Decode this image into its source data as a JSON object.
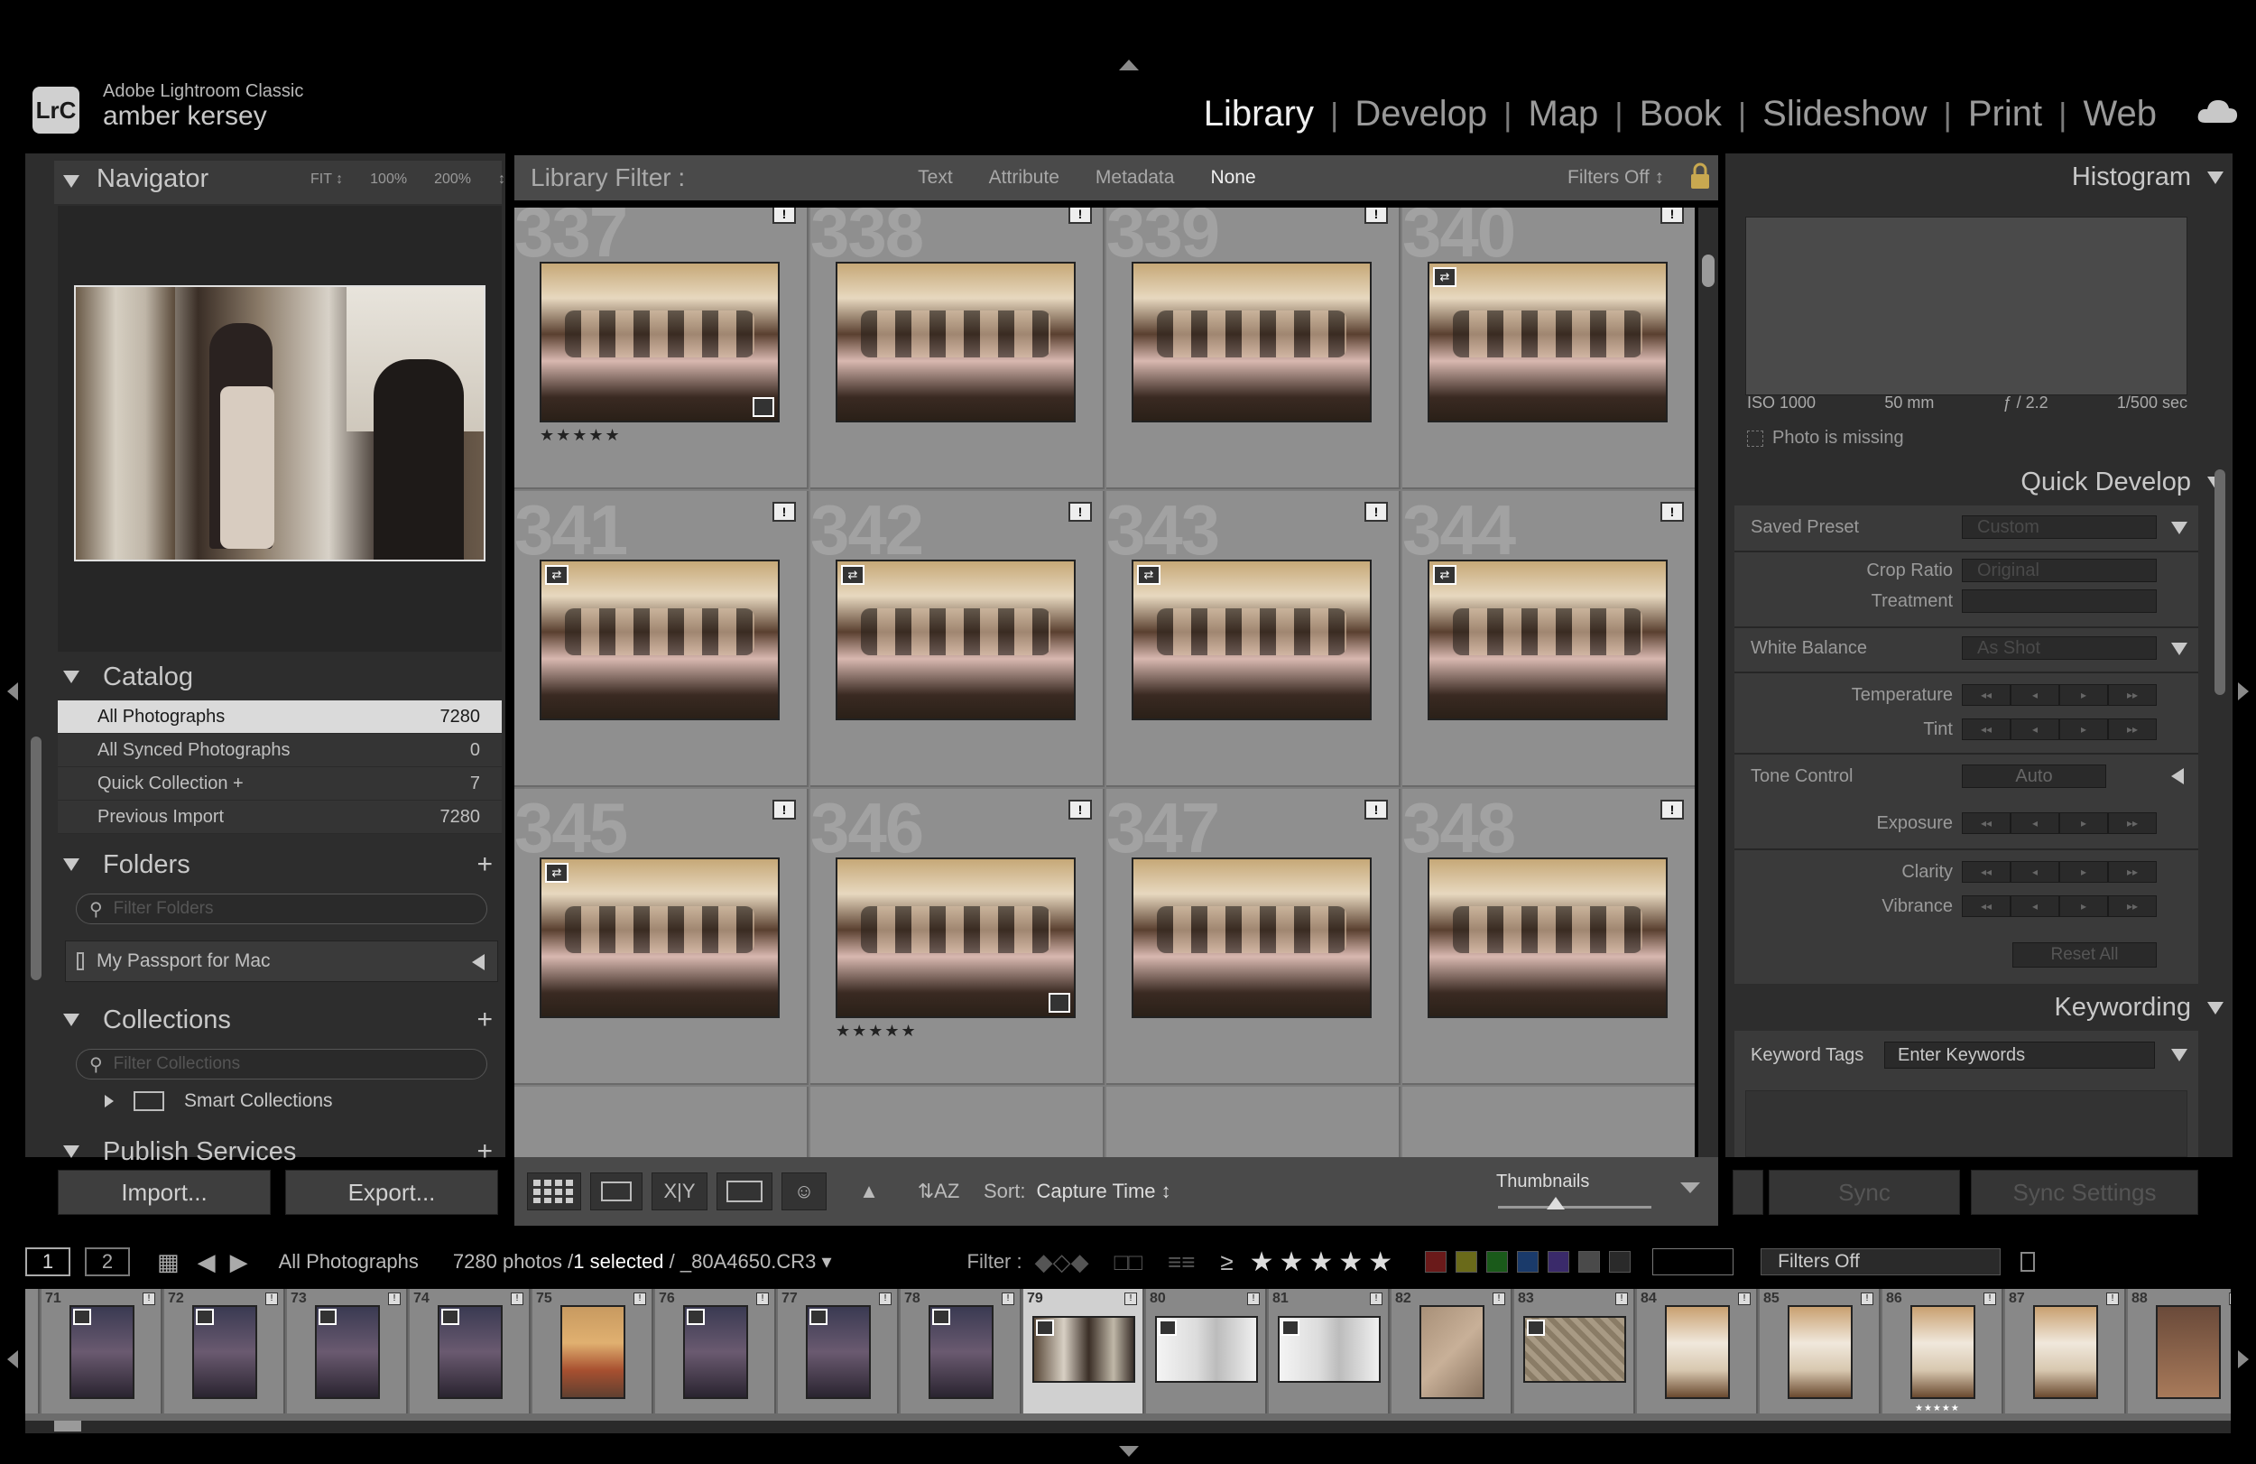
{
  "app": {
    "logo": "LrC",
    "name": "Adobe Lightroom Classic",
    "user": "amber kersey"
  },
  "modules": [
    {
      "label": "Library",
      "active": true
    },
    {
      "label": "Develop"
    },
    {
      "label": "Map"
    },
    {
      "label": "Book"
    },
    {
      "label": "Slideshow"
    },
    {
      "label": "Print"
    },
    {
      "label": "Web"
    }
  ],
  "navigator": {
    "title": "Navigator",
    "zoom": [
      "FIT ↕",
      "100%",
      "200%",
      "↕"
    ]
  },
  "catalog": {
    "title": "Catalog",
    "items": [
      {
        "label": "All Photographs",
        "count": "7280",
        "selected": true
      },
      {
        "label": "All Synced Photographs",
        "count": "0"
      },
      {
        "label": "Quick Collection +",
        "count": "7"
      },
      {
        "label": "Previous Import",
        "count": "7280"
      }
    ]
  },
  "folders": {
    "title": "Folders",
    "filter_placeholder": "Filter Folders",
    "device": "My Passport for Mac"
  },
  "collections": {
    "title": "Collections",
    "filter_placeholder": "Filter Collections",
    "smart": "Smart Collections"
  },
  "publish": {
    "title": "Publish Services"
  },
  "buttons": {
    "import": "Import...",
    "export": "Export..."
  },
  "library_filter": {
    "title": "Library Filter :",
    "tabs": [
      "Text",
      "Attribute",
      "Metadata",
      "None"
    ],
    "active_tab": "None",
    "filters": "Filters Off ↕"
  },
  "grid": {
    "cells": [
      {
        "num": "337",
        "badge": "!",
        "sync": false,
        "edited": true,
        "stars": "★★★★★"
      },
      {
        "num": "338",
        "badge": "!",
        "sync": false,
        "edited": false,
        "stars": ""
      },
      {
        "num": "339",
        "badge": "!",
        "sync": false,
        "edited": false,
        "stars": ""
      },
      {
        "num": "340",
        "badge": "!",
        "sync": true,
        "edited": false,
        "stars": ""
      },
      {
        "num": "341",
        "badge": "!",
        "sync": true,
        "edited": false,
        "stars": ""
      },
      {
        "num": "342",
        "badge": "!",
        "sync": true,
        "edited": false,
        "stars": ""
      },
      {
        "num": "343",
        "badge": "!",
        "sync": true,
        "edited": false,
        "stars": ""
      },
      {
        "num": "344",
        "badge": "!",
        "sync": true,
        "edited": false,
        "stars": ""
      },
      {
        "num": "345",
        "badge": "!",
        "sync": true,
        "edited": false,
        "stars": ""
      },
      {
        "num": "346",
        "badge": "!",
        "sync": false,
        "edited": true,
        "stars": "★★★★★"
      },
      {
        "num": "347",
        "badge": "!",
        "sync": false,
        "edited": false,
        "stars": ""
      },
      {
        "num": "348",
        "badge": "!",
        "sync": false,
        "edited": false,
        "stars": ""
      }
    ]
  },
  "toolbar": {
    "sort_label": "Sort:",
    "sort_value": "Capture Time ↕",
    "thumbnails_label": "Thumbnails"
  },
  "histogram": {
    "title": "Histogram",
    "iso": "ISO 1000",
    "focal": "50 mm",
    "aperture": "ƒ / 2.2",
    "shutter": "1/500 sec",
    "missing": "Photo is missing"
  },
  "quick_develop": {
    "title": "Quick Develop",
    "saved_preset_label": "Saved Preset",
    "saved_preset_value": "Custom",
    "crop_ratio_label": "Crop Ratio",
    "crop_ratio_value": "Original",
    "treatment_label": "Treatment",
    "white_balance_label": "White Balance",
    "white_balance_value": "As Shot",
    "temperature_label": "Temperature",
    "tint_label": "Tint",
    "tone_control_label": "Tone Control",
    "auto_label": "Auto",
    "exposure_label": "Exposure",
    "clarity_label": "Clarity",
    "vibrance_label": "Vibrance",
    "reset_all": "Reset All",
    "steps": [
      "◂◂",
      "◂",
      "▸",
      "▸▸"
    ]
  },
  "keywording": {
    "title": "Keywording",
    "tags_label": "Keyword Tags",
    "tags_value": "Enter Keywords"
  },
  "sync": {
    "sync": "Sync",
    "sync_settings": "Sync Settings"
  },
  "filmstrip_header": {
    "monitor1": "1",
    "monitor2": "2",
    "source": "All Photographs",
    "count": "7280 photos /",
    "selected": "1 selected",
    "filename": "/ _80A4650.CR3 ▾",
    "filter_label": "Filter :",
    "rating_op": "≥",
    "stars": "★★★★★",
    "filters_off": "Filters Off",
    "swatches": [
      "#6a1a1a",
      "#6a6a1a",
      "#1a5a1a",
      "#1a3a6a",
      "#3a2a6a",
      "#4a4a4a",
      "#2a2a2a"
    ]
  },
  "filmstrip": [
    {
      "num": "",
      "kind": "partial"
    },
    {
      "num": "71",
      "kind": "portrait"
    },
    {
      "num": "72",
      "kind": "portrait"
    },
    {
      "num": "73",
      "kind": "portrait"
    },
    {
      "num": "74",
      "kind": "portrait"
    },
    {
      "num": "75",
      "kind": "portrait-warm"
    },
    {
      "num": "76",
      "kind": "portrait"
    },
    {
      "num": "77",
      "kind": "portrait"
    },
    {
      "num": "78",
      "kind": "portrait"
    },
    {
      "num": "79",
      "kind": "landscape",
      "selected": true
    },
    {
      "num": "80",
      "kind": "landscape-bright"
    },
    {
      "num": "81",
      "kind": "landscape-bright"
    },
    {
      "num": "82",
      "kind": "portrait-tan"
    },
    {
      "num": "83",
      "kind": "landscape-tan"
    },
    {
      "num": "84",
      "kind": "portrait-dress"
    },
    {
      "num": "85",
      "kind": "portrait-dress"
    },
    {
      "num": "86",
      "kind": "portrait-dress",
      "stars": "★★★★★"
    },
    {
      "num": "87",
      "kind": "portrait-dress"
    },
    {
      "num": "88",
      "kind": "partial"
    }
  ]
}
